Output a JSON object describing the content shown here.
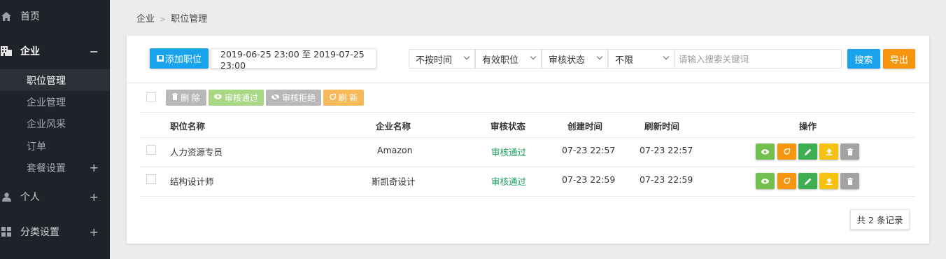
{
  "sidebar": {
    "items": [
      {
        "label": "首页",
        "icon": "home-icon"
      },
      {
        "label": "企业",
        "icon": "building-icon",
        "toggle": "−"
      },
      {
        "label": "个人",
        "icon": "user-icon",
        "toggle": "+"
      },
      {
        "label": "分类设置",
        "icon": "grid-icon",
        "toggle": "+"
      }
    ],
    "sub_items": [
      {
        "label": "职位管理"
      },
      {
        "label": "企业管理"
      },
      {
        "label": "企业风采"
      },
      {
        "label": "订单"
      },
      {
        "label": "套餐设置",
        "toggle": "+"
      }
    ]
  },
  "breadcrumb": {
    "parent": "企业",
    "separator": ">",
    "current": "职位管理"
  },
  "toolbar": {
    "add_label": "添加职位",
    "date_range": "2019-06-25 23:00 至 2019-07-25 23:00",
    "filters": [
      "不按时间",
      "有效职位",
      "审核状态",
      "不限"
    ],
    "search_placeholder": "请输入搜索关键词",
    "search_label": "搜索",
    "export_label": "导出"
  },
  "actions": {
    "delete": "删 除",
    "approve": "审核通过",
    "reject": "审核拒绝",
    "refresh": "刷 新"
  },
  "table": {
    "headers": [
      "职位名称",
      "企业名称",
      "审核状态",
      "创建时间",
      "刷新时间",
      "操作"
    ],
    "rows": [
      {
        "name": "人力资源专员",
        "company": "Amazon",
        "status": "审核通过",
        "created": "07-23 22:57",
        "refreshed": "07-23 22:57"
      },
      {
        "name": "结构设计师",
        "company": "斯凯奇设计",
        "status": "审核通过",
        "created": "07-23 22:59",
        "refreshed": "07-23 22:59"
      }
    ]
  },
  "pager": {
    "summary": "共 2 条记录"
  },
  "colors": {
    "primary": "#1aa3ea",
    "warning": "#f6960f",
    "success": "#1aa05f",
    "sidebar": "#1f2329"
  }
}
